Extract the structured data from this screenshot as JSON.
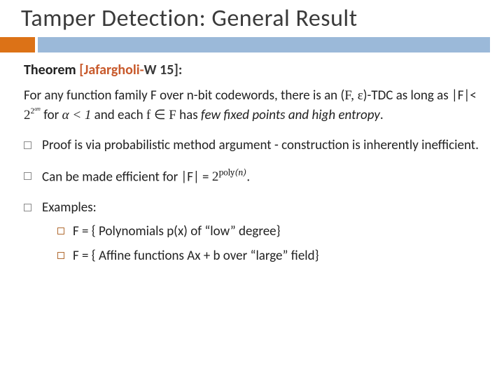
{
  "title": "Tamper Detection: General Result",
  "theorem_label": "Theorem",
  "cite_prefix": "[Jafargholi-",
  "cite_suffix": "W 15]:",
  "para_pre": "For any function family ",
  "para_F": "F",
  "para_mid1": " over  n-bit codewords, there is an (",
  "para_Feps": "F, ε",
  "para_mid2": ")-TDC as long as |",
  "para_F2": "F",
  "para_mid3": "|< ",
  "para_expr_base": "2",
  "para_expr_exp1": "2",
  "para_expr_exp2": "αn",
  "para_for": " for ",
  "para_alpha": "α < 1",
  "para_and": " and each  ",
  "para_fmem": "f ∈ F",
  "para_has": " has ",
  "para_fix": "few fixed points",
  "para_and2": " and ",
  "para_high": "high entropy",
  "para_dot": ".",
  "b1": "Proof is via probabilistic method argument  -  construction is inherently inefficient.",
  "b2_pre": "Can be made efficient for  |F| = ",
  "b2_base": "2",
  "b2_poly": "poly",
  "b2_n": "(n)",
  "b2_dot": ".",
  "b3": "Examples:",
  "s1": "F = { Polynomials p(x) of “low” degree}",
  "s2": "F = { Affine functions Ax + b over “large” field}"
}
